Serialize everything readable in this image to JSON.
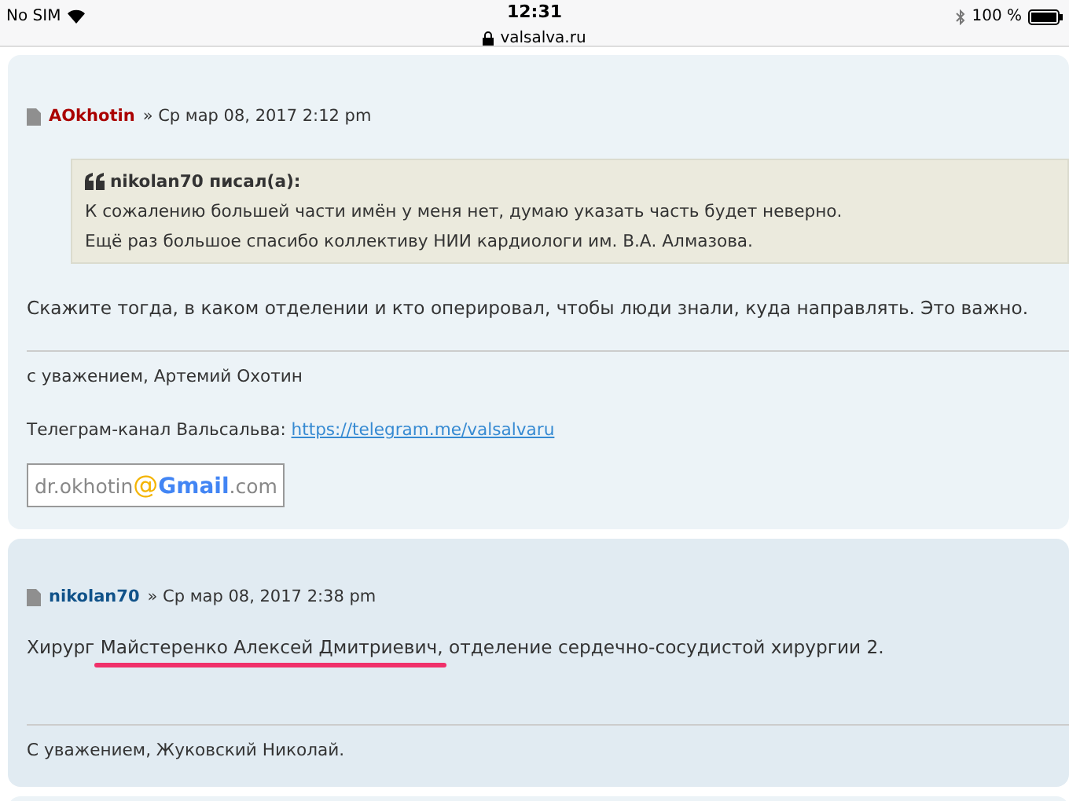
{
  "status_bar": {
    "carrier": "No SIM",
    "time": "12:31",
    "url": "valsalva.ru",
    "battery": "100 %"
  },
  "posts": [
    {
      "author": "AOkhotin",
      "color": "#aa0000",
      "date": "» Ср мар 08, 2017 2:12 pm",
      "quote": {
        "author": "nikolan70 писал(а):",
        "lines": [
          "К сожалению большей части имён у меня нет, думаю указать часть будет неверно.",
          "Ещё раз большое спасибо коллективу НИИ кардиологи им. В.А. Алмазова."
        ]
      },
      "body": [
        {
          "text": "Скажите тогда, в каком отделении и кто оперировал, чтобы люди знали, куда направлять. Это важно."
        }
      ],
      "signature": [
        {
          "kind": "text",
          "text": "с уважением, Артемий Охотин"
        },
        {
          "kind": "link",
          "text": "Телеграм-канал Вальсальва: ",
          "link": "https://telegram.me/valsalvaru"
        },
        {
          "kind": "email",
          "user": "dr.okhotin",
          "at": "@",
          "brand": "Gmail",
          "domain": ".com"
        }
      ]
    },
    {
      "author": "nikolan70",
      "color": "#105289",
      "date": "» Ср мар 08, 2017 2:38 pm",
      "body": [
        {
          "text": "Хирург "
        },
        {
          "text": "Майстеренко Алексей Дмитриевич,",
          "underlined": true
        },
        {
          "text": " отделение сердечно-сосудистой хирургии 2."
        }
      ],
      "signature": [
        {
          "kind": "text",
          "text": "С уважением, Жуковский Николай."
        }
      ]
    }
  ]
}
